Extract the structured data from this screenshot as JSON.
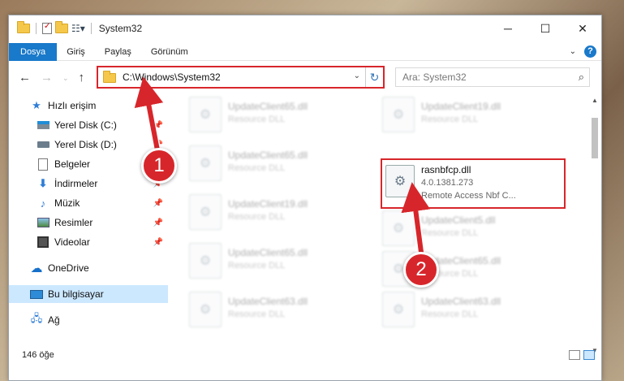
{
  "window": {
    "title": "System32"
  },
  "ribbon": {
    "tabs": [
      "Dosya",
      "Giriş",
      "Paylaş",
      "Görünüm"
    ]
  },
  "address": {
    "path": "C:\\Windows\\System32",
    "search_placeholder": "Ara: System32"
  },
  "sidebar": {
    "items": [
      {
        "label": "Hızlı erişim",
        "icon": "star-icon"
      },
      {
        "label": "Yerel Disk (C:)",
        "icon": "drive-icon"
      },
      {
        "label": "Yerel Disk (D:)",
        "icon": "drive-icon"
      },
      {
        "label": "Belgeler",
        "icon": "documents-icon"
      },
      {
        "label": "İndirmeler",
        "icon": "download-icon"
      },
      {
        "label": "Müzik",
        "icon": "music-icon"
      },
      {
        "label": "Resimler",
        "icon": "pictures-icon"
      },
      {
        "label": "Videolar",
        "icon": "videos-icon"
      },
      {
        "label": "OneDrive",
        "icon": "cloud-icon"
      },
      {
        "label": "Bu bilgisayar",
        "icon": "computer-icon"
      },
      {
        "label": "Ağ",
        "icon": "network-icon"
      }
    ]
  },
  "files": {
    "col1": [
      {
        "name": "UpdateClient65.dll",
        "sub": "Resource DLL"
      },
      {
        "name": "UpdateClient65.dll",
        "sub": "Resource DLL"
      },
      {
        "name": "UpdateClient19.dll",
        "sub": "Resource DLL"
      },
      {
        "name": "UpdateClient65.dll",
        "sub": "Resource DLL"
      },
      {
        "name": "UpdateClient63.dll",
        "sub": "Resource DLL"
      }
    ],
    "col2": [
      {
        "name": "UpdateClient19.dll",
        "sub": "Resource DLL"
      },
      {
        "name": "rasnbfcp.dll",
        "sub": "4.0.1381.273",
        "sub2": "Remote Access Nbf C..."
      },
      {
        "name": "UpdateClient5.dll",
        "sub": "Resource DLL"
      },
      {
        "name": "UpdateClient65.dll",
        "sub": "Resource DLL"
      },
      {
        "name": "UpdateClient63.dll",
        "sub": "Resource DLL"
      }
    ]
  },
  "status": {
    "count": "146 öğe"
  },
  "annotations": {
    "badge1": "1",
    "badge2": "2"
  },
  "colors": {
    "accent": "#1979ca",
    "highlight": "#d7262b"
  }
}
